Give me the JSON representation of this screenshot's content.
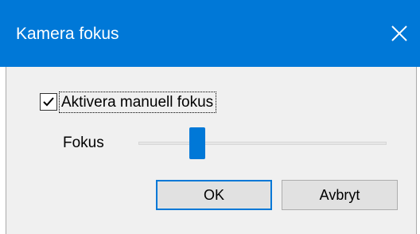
{
  "window": {
    "title": "Kamera fokus",
    "title_bar_color": "#0078d7",
    "close_icon": "close-icon"
  },
  "options": {
    "manual_focus_checkbox": {
      "label": "Aktivera manuell fokus",
      "checked": true
    }
  },
  "focus": {
    "label": "Fokus",
    "slider_value_fraction": 0.22,
    "thumb_color": "#0078d7"
  },
  "buttons": {
    "ok_label": "OK",
    "cancel_label": "Avbryt"
  }
}
